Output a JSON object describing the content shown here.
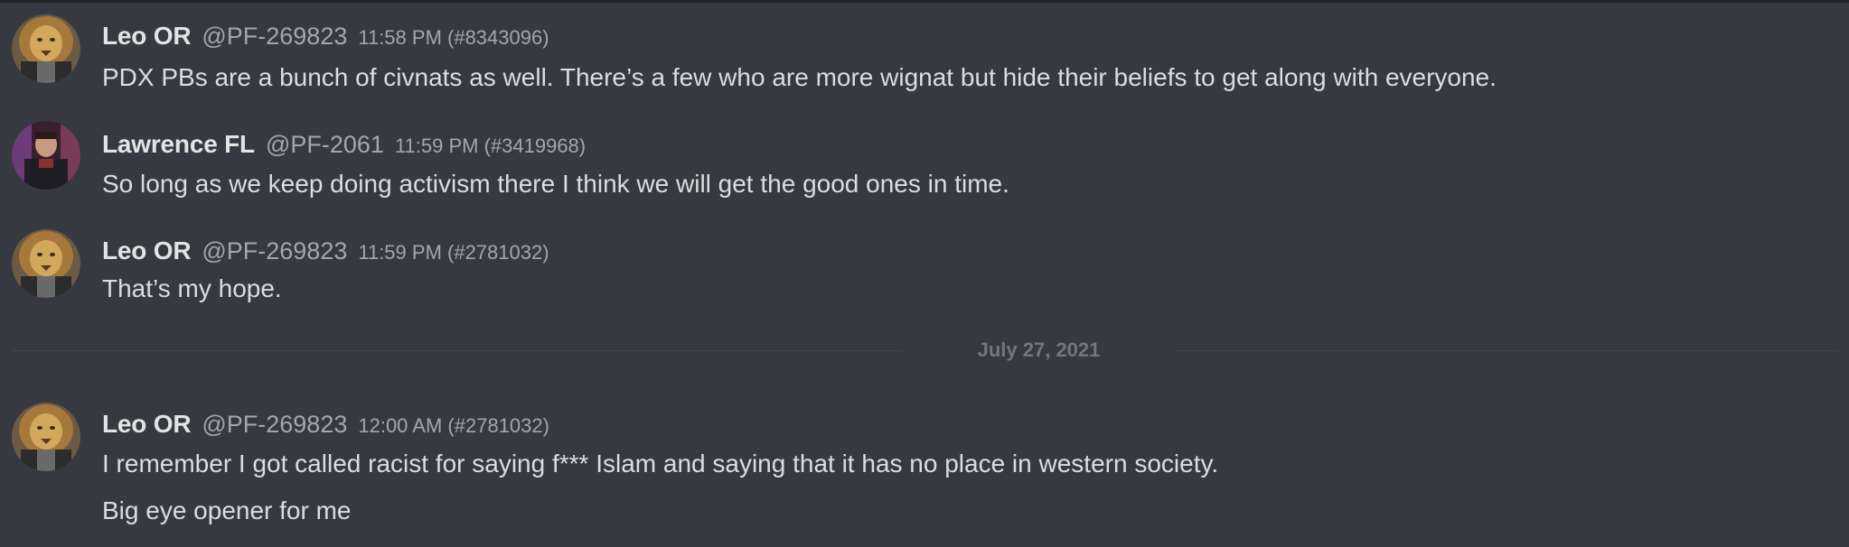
{
  "messages": [
    {
      "username": "Leo OR",
      "handle": "@PF-269823",
      "timestamp": "11:58 PM (#8343096)",
      "avatar_icon": "lion-avatar-icon",
      "lines": [
        "PDX PBs are a bunch of civnats as well. There’s a few who are more wignat but hide their beliefs to get along with everyone."
      ]
    },
    {
      "username": "Lawrence FL",
      "handle": "@PF-2061",
      "timestamp": "11:59 PM (#3419968)",
      "avatar_icon": "person-avatar-icon",
      "lines": [
        "So long as we keep doing activism there I think we will get the good ones in time."
      ]
    },
    {
      "username": "Leo OR",
      "handle": "@PF-269823",
      "timestamp": "11:59 PM (#2781032)",
      "avatar_icon": "lion-avatar-icon",
      "lines": [
        "That’s my hope."
      ]
    },
    {
      "username": "Leo OR",
      "handle": "@PF-269823",
      "timestamp": "12:00 AM (#2781032)",
      "avatar_icon": "lion-avatar-icon",
      "lines": [
        "I remember I got called racist for saying f*** Islam and saying that it has no place in western society.",
        "Big eye opener for me"
      ]
    }
  ],
  "date_divider": "July 27, 2021",
  "colors": {
    "background": "#36393f",
    "username": "#e3e3e3",
    "meta": "#a3a6aa",
    "text": "#dcddde",
    "divider": "#42454a"
  }
}
